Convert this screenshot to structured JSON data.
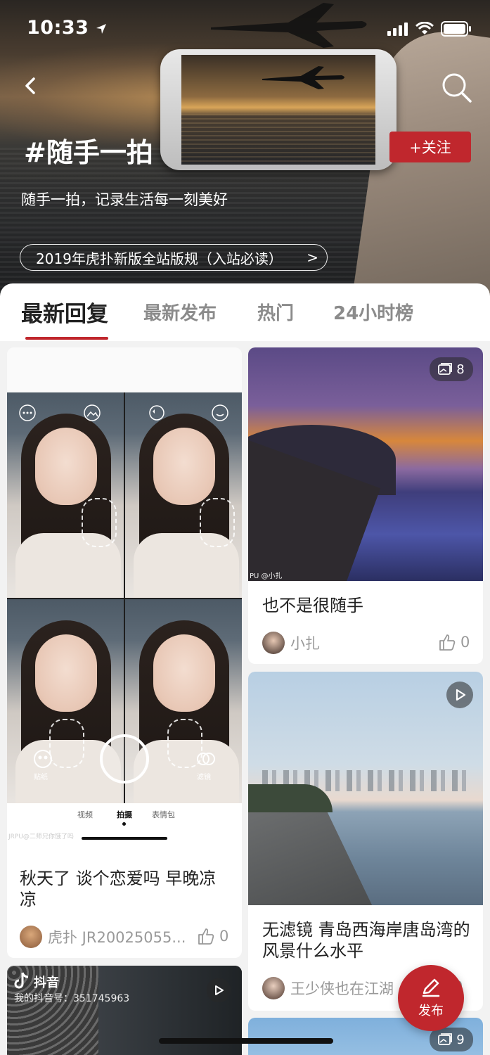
{
  "status_bar": {
    "time": "10:33"
  },
  "header": {
    "topic_title": "#随手一拍",
    "follow_label": "+关注",
    "description": "随手一拍，记录生活每一刻美好",
    "rules_link": "2019年虎扑新版全站版规（入站必读）",
    "rules_arrow": ">"
  },
  "tabs": [
    {
      "label": "最新回复",
      "active": true
    },
    {
      "label": "最新发布",
      "active": false
    },
    {
      "label": "热门",
      "active": false
    },
    {
      "label": "24小时榜",
      "active": false
    }
  ],
  "posts": [
    {
      "title": "秋天了 谈个恋爱吗 早晚凉凉",
      "author": "虎扑 JR20025055...",
      "likes": "0",
      "image_tabs": [
        "视频",
        "拍摄",
        "表情包"
      ],
      "image_labels": [
        "贴纸",
        "滤镜"
      ],
      "watermark": "JRPU@二师兄你饿了吗"
    },
    {
      "title": "也不是很随手",
      "author": "小扎",
      "likes": "0",
      "image_count": "8",
      "watermark": "PU @小扎"
    },
    {
      "title": "无滤镜 青岛西海岸唐岛湾的风景什么水平",
      "author": "王少侠也在江湖",
      "likes": "0",
      "media_type": "video"
    },
    {
      "watermark_brand": "抖音",
      "watermark_id": "我的抖音号：351745963",
      "media_type": "video"
    },
    {
      "image_count": "9"
    }
  ],
  "fab": {
    "label": "发布"
  },
  "colors": {
    "accent": "#c0272d"
  }
}
